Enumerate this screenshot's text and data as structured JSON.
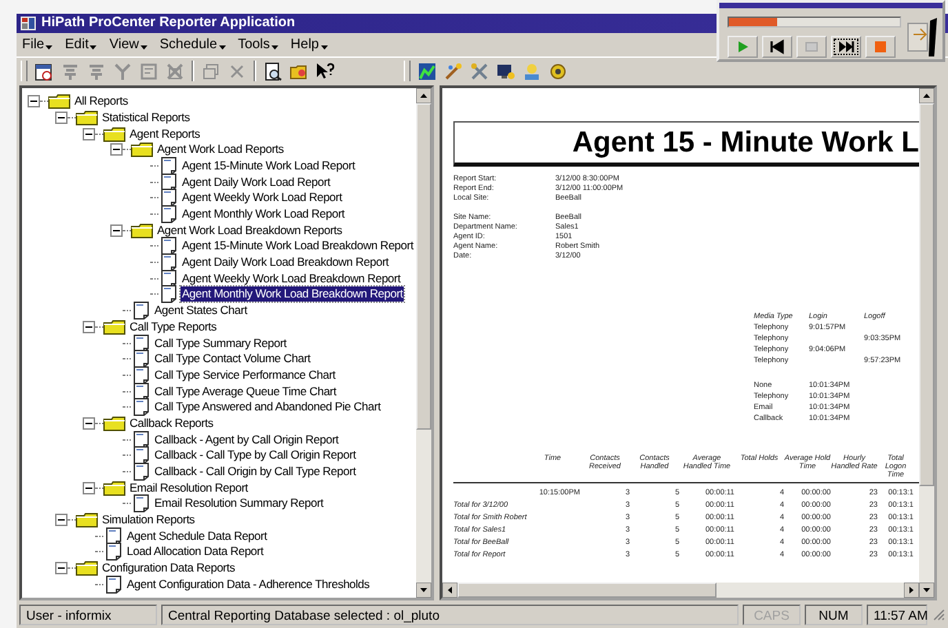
{
  "window": {
    "title": "HiPath ProCenter Reporter Application"
  },
  "menu": [
    "File",
    "Edit",
    "View",
    "Schedule",
    "Tools",
    "Help"
  ],
  "player": {
    "level": 0.28
  },
  "tree": [
    {
      "label": "All Reports",
      "kind": "folder",
      "expanded": true,
      "selected": false,
      "children": [
        {
          "label": "Statistical Reports",
          "kind": "folder",
          "expanded": true,
          "selected": false,
          "children": [
            {
              "label": "Agent Reports",
              "kind": "folder",
              "expanded": true,
              "selected": false,
              "children": [
                {
                  "label": "Agent Work Load Reports",
                  "kind": "folder",
                  "expanded": true,
                  "selected": false,
                  "children": [
                    {
                      "label": "Agent 15-Minute Work Load Report",
                      "kind": "report",
                      "selected": false
                    },
                    {
                      "label": "Agent Daily Work Load Report",
                      "kind": "report",
                      "selected": false
                    },
                    {
                      "label": "Agent Weekly Work Load Report",
                      "kind": "report",
                      "selected": false
                    },
                    {
                      "label": "Agent Monthly Work Load Report",
                      "kind": "report",
                      "selected": false
                    }
                  ]
                },
                {
                  "label": "Agent Work Load Breakdown Reports",
                  "kind": "folder",
                  "expanded": true,
                  "selected": false,
                  "children": [
                    {
                      "label": "Agent 15-Minute Work Load Breakdown Report",
                      "kind": "report",
                      "selected": false
                    },
                    {
                      "label": "Agent Daily Work Load Breakdown Report",
                      "kind": "report",
                      "selected": false
                    },
                    {
                      "label": "Agent Weekly Work Load Breakdown Report",
                      "kind": "report",
                      "selected": false
                    },
                    {
                      "label": "Agent Monthly Work Load Breakdown Report",
                      "kind": "report",
                      "selected": true
                    }
                  ]
                },
                {
                  "label": "Agent States Chart",
                  "kind": "report",
                  "selected": false
                }
              ]
            },
            {
              "label": "Call Type Reports",
              "kind": "folder",
              "expanded": true,
              "selected": false,
              "children": [
                {
                  "label": "Call Type Summary Report",
                  "kind": "report",
                  "selected": false
                },
                {
                  "label": "Call Type Contact Volume Chart",
                  "kind": "report",
                  "selected": false
                },
                {
                  "label": "Call Type Service Performance Chart",
                  "kind": "report",
                  "selected": false
                },
                {
                  "label": "Call Type Average Queue Time Chart",
                  "kind": "report",
                  "selected": false
                },
                {
                  "label": "Call Type Answered and Abandoned Pie Chart",
                  "kind": "report",
                  "selected": false
                }
              ]
            },
            {
              "label": "Callback Reports",
              "kind": "folder",
              "expanded": true,
              "selected": false,
              "children": [
                {
                  "label": "Callback - Agent by Call Origin Report",
                  "kind": "report",
                  "selected": false
                },
                {
                  "label": "Callback - Call Type by Call Origin Report",
                  "kind": "report",
                  "selected": false
                },
                {
                  "label": "Callback - Call Origin by Call Type Report",
                  "kind": "report",
                  "selected": false
                }
              ]
            },
            {
              "label": "Email Resolution Report",
              "kind": "folder",
              "expanded": true,
              "selected": false,
              "children": [
                {
                  "label": "Email Resolution Summary Report",
                  "kind": "report",
                  "selected": false
                }
              ]
            }
          ]
        },
        {
          "label": "Simulation Reports",
          "kind": "folder",
          "expanded": true,
          "selected": false,
          "children": [
            {
              "label": "Agent Schedule Data Report",
              "kind": "report",
              "selected": false
            },
            {
              "label": "Load Allocation Data Report",
              "kind": "report",
              "selected": false
            }
          ]
        },
        {
          "label": "Configuration Data Reports",
          "kind": "folder",
          "expanded": true,
          "selected": false,
          "children": [
            {
              "label": "Agent Configuration Data - Adherence Thresholds",
              "kind": "report",
              "selected": false
            }
          ]
        }
      ]
    }
  ],
  "report": {
    "title": "Agent 15 - Minute Work L",
    "field_groups": [
      [
        {
          "label": "Report Start:",
          "value": "3/12/00  8:30:00PM"
        },
        {
          "label": "Report End:",
          "value": "3/12/00  11:00:00PM"
        },
        {
          "label": "Local Site:",
          "value": "BeeBall"
        }
      ],
      [
        {
          "label": "Site Name:",
          "value": "BeeBall"
        },
        {
          "label": "Department Name:",
          "value": "Sales1"
        },
        {
          "label": "Agent ID:",
          "value": "1501"
        },
        {
          "label": "Agent Name:",
          "value": "Robert  Smith"
        },
        {
          "label": "Date:",
          "value": "3/12/00"
        }
      ]
    ],
    "media_columns": [
      "Media Type",
      "Login",
      "Logoff"
    ],
    "media_groups": [
      [
        {
          "media": "Telephony",
          "login": "9:01:57PM"
        },
        {
          "media": "Telephony",
          "logoff": "9:03:35PM"
        },
        {
          "media": "Telephony",
          "login": "9:04:06PM"
        },
        {
          "media": "Telephony",
          "logoff": "9:57:23PM"
        }
      ],
      [
        {
          "media": "None",
          "login": "10:01:34PM"
        },
        {
          "media": "Telephony",
          "login": "10:01:34PM"
        },
        {
          "media": "Email",
          "login": "10:01:34PM"
        },
        {
          "media": "Callback",
          "login": "10:01:34PM"
        }
      ]
    ],
    "columns": [
      "Time",
      "Contacts Received",
      "Contacts Handled",
      "Average Handled Time",
      "Total Holds",
      "Average Hold Time",
      "Hourly Handled Rate",
      "Total Logon Time"
    ],
    "rows": [
      {
        "cells": [
          "10:15:00PM",
          "3",
          "5",
          "00:00:11",
          "4",
          "00:00:00",
          "23",
          "00:13:1"
        ]
      },
      {
        "label": "Total for  3/12/00",
        "cells": [
          "",
          "3",
          "5",
          "00:00:11",
          "4",
          "00:00:00",
          "23",
          "00:13:1"
        ]
      },
      {
        "label": "Total for  Smith Robert",
        "cells": [
          "",
          "3",
          "5",
          "00:00:11",
          "4",
          "00:00:00",
          "23",
          "00:13:1"
        ]
      },
      {
        "label": "Total for  Sales1",
        "cells": [
          "",
          "3",
          "5",
          "00:00:11",
          "4",
          "00:00:00",
          "23",
          "00:13:1"
        ]
      },
      {
        "label": "Total for  BeeBall",
        "cells": [
          "",
          "3",
          "5",
          "00:00:11",
          "4",
          "00:00:00",
          "23",
          "00:13:1"
        ]
      },
      {
        "label": "Total for Report",
        "cells": [
          "",
          "3",
          "5",
          "00:00:11",
          "4",
          "00:00:00",
          "23",
          "00:13:1"
        ]
      }
    ]
  },
  "status_bar": {
    "user": "User - informix",
    "database": "Central Reporting Database selected : ol_pluto",
    "indicators": [
      {
        "text": "CAPS",
        "enabled": false
      },
      {
        "text": "NUM",
        "enabled": true
      }
    ],
    "time": "11:57 AM"
  }
}
